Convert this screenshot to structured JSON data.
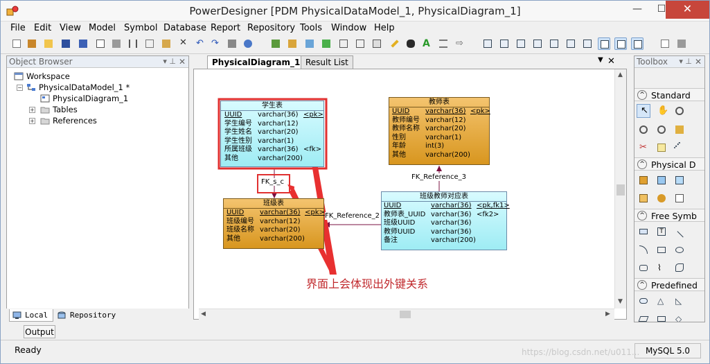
{
  "window": {
    "title": "PowerDesigner [PDM PhysicalDataModel_1, PhysicalDiagram_1]",
    "minimize_glyph": "—",
    "maximize_glyph": "☐",
    "close_glyph": "✕"
  },
  "menu": [
    "File",
    "Edit",
    "View",
    "Model",
    "Symbol",
    "Database",
    "Report",
    "Repository",
    "Tools",
    "Window",
    "Help"
  ],
  "object_browser": {
    "title": "Object Browser",
    "tree": {
      "workspace": "Workspace",
      "model": "PhysicalDataModel_1 *",
      "diagram": "PhysicalDiagram_1",
      "tables": "Tables",
      "references": "References"
    },
    "tabs": {
      "local": "Local",
      "repository": "Repository"
    }
  },
  "diagram_tabs": {
    "active": "PhysicalDiagram_1",
    "other": "Result List"
  },
  "entities": {
    "student": {
      "name": "学生表",
      "rows": [
        {
          "col": "UUID",
          "type": "varchar(36)",
          "key": "<pk>"
        },
        {
          "col": "学生编号",
          "type": "varchar(12)",
          "key": ""
        },
        {
          "col": "学生姓名",
          "type": "varchar(20)",
          "key": ""
        },
        {
          "col": "学生性别",
          "type": "varchar(1)",
          "key": ""
        },
        {
          "col": "所属班级",
          "type": "varchar(36)",
          "key": "<fk>"
        },
        {
          "col": "其他",
          "type": "varchar(200)",
          "key": ""
        }
      ]
    },
    "teacher": {
      "name": "教师表",
      "rows": [
        {
          "col": "UUID",
          "type": "varchar(36)",
          "key": "<pk>"
        },
        {
          "col": "教师编号",
          "type": "varchar(12)",
          "key": ""
        },
        {
          "col": "教师名称",
          "type": "varchar(20)",
          "key": ""
        },
        {
          "col": "性别",
          "type": "varchar(1)",
          "key": ""
        },
        {
          "col": "年龄",
          "type": "int(3)",
          "key": ""
        },
        {
          "col": "其他",
          "type": "varchar(200)",
          "key": ""
        }
      ]
    },
    "class": {
      "name": "班级表",
      "rows": [
        {
          "col": "UUID",
          "type": "varchar(36)",
          "key": "<pk>"
        },
        {
          "col": "班级编号",
          "type": "varchar(12)",
          "key": ""
        },
        {
          "col": "班级名称",
          "type": "varchar(20)",
          "key": ""
        },
        {
          "col": "其他",
          "type": "varchar(200)",
          "key": ""
        }
      ]
    },
    "class_teacher": {
      "name": "班级教师对应表",
      "rows": [
        {
          "col": "UUID",
          "type": "varchar(36)",
          "key": "<pk,fk1>"
        },
        {
          "col": "教师表_UUID",
          "type": "varchar(36)",
          "key": "<fk2>"
        },
        {
          "col": "班级UUID",
          "type": "varchar(36)",
          "key": ""
        },
        {
          "col": "教师UUID",
          "type": "varchar(36)",
          "key": ""
        },
        {
          "col": "备注",
          "type": "varchar(200)",
          "key": ""
        }
      ]
    }
  },
  "references": {
    "fk_s_c": "FK_s_c",
    "fk_ref_2": "FK_Reference_2",
    "fk_ref_3": "FK_Reference_3"
  },
  "annotation": "界面上会体现出外键关系",
  "toolbox": {
    "title": "Toolbox",
    "groups": [
      "Standard",
      "Physical D",
      "Free Symb",
      "Predefined"
    ]
  },
  "output_tab": "Output",
  "status": {
    "text": "Ready",
    "db": "MySQL 5.0",
    "watermark": "https://blog.csdn.net/u011..."
  },
  "colors": {
    "entity_brown": "#d8961f",
    "entity_cyan": "#9eecf4",
    "highlight_red": "#e03030",
    "reference_line": "#7a1040",
    "annotation_text": "#c0282c"
  }
}
